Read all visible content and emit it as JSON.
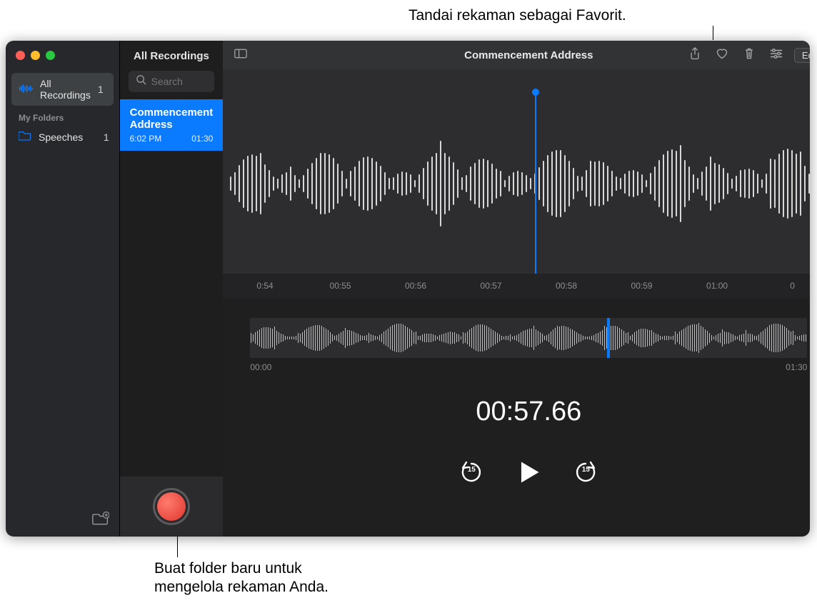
{
  "callouts": {
    "top": "Tandai rekaman sebagai Favorit.",
    "bottom1": "Buat folder baru untuk",
    "bottom2": "mengelola rekaman Anda."
  },
  "sidebar": {
    "items": [
      {
        "label": "All Recordings",
        "count": "1"
      }
    ],
    "section": "My Folders",
    "folders": [
      {
        "label": "Speeches",
        "count": "1"
      }
    ]
  },
  "list": {
    "header": "All Recordings",
    "search_placeholder": "Search",
    "items": [
      {
        "title": "Commencement Address",
        "time": "6:02 PM",
        "duration": "01:30"
      }
    ]
  },
  "toolbar": {
    "title": "Commencement Address",
    "edit": "Edit"
  },
  "ruler": [
    "0:54",
    "00:55",
    "00:56",
    "00:57",
    "00:58",
    "00:59",
    "01:00",
    "0"
  ],
  "overview": {
    "start": "00:00",
    "end": "01:30"
  },
  "timecode": "00:57.66",
  "controls": {
    "back_sec": "15",
    "fwd_sec": "15"
  }
}
